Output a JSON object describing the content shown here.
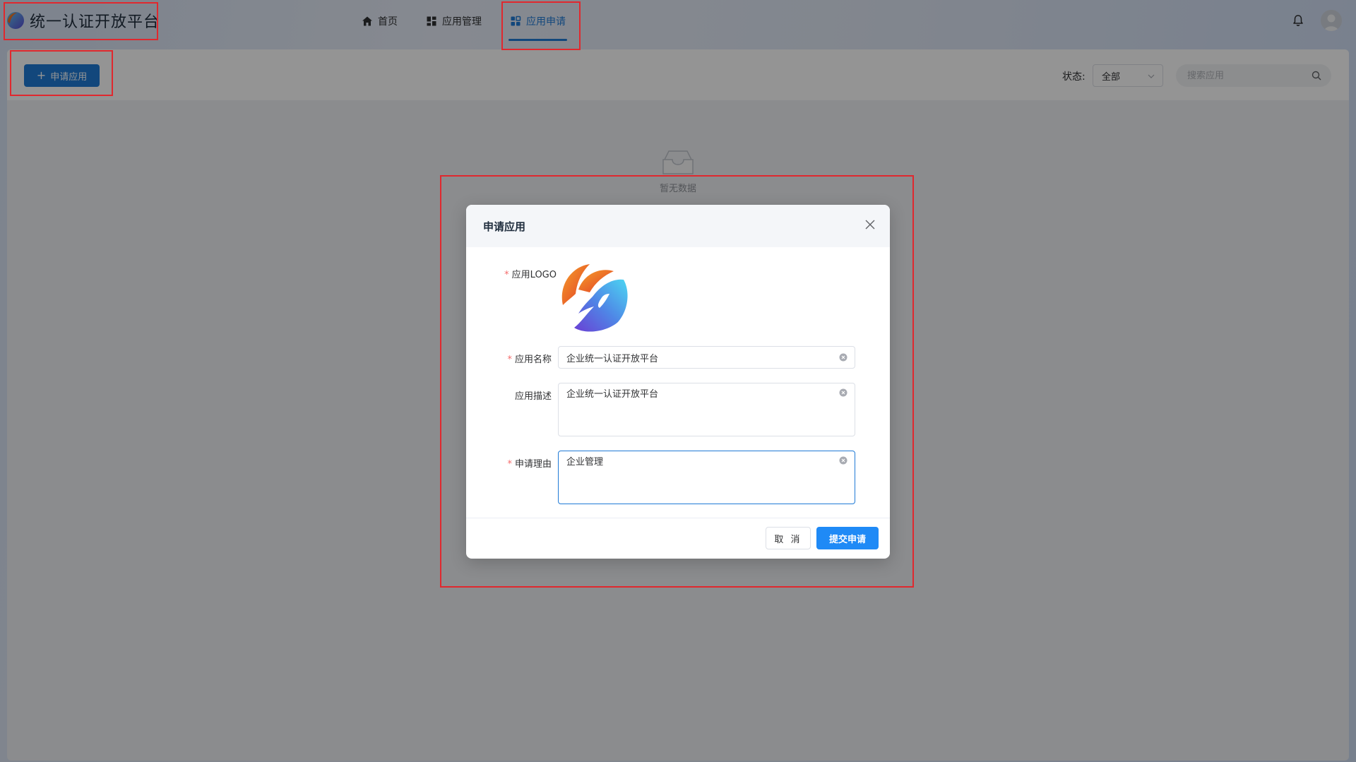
{
  "app": {
    "title": "统一认证开放平台"
  },
  "nav": {
    "items": [
      {
        "label": "首页",
        "icon": "home-icon",
        "active": false
      },
      {
        "label": "应用管理",
        "icon": "dashboard-icon",
        "active": false
      },
      {
        "label": "应用申请",
        "icon": "apps-icon",
        "active": true
      }
    ]
  },
  "toolbar": {
    "apply_label": "申请应用",
    "status_label": "状态:",
    "status_value": "全部",
    "search_placeholder": "搜索应用"
  },
  "empty": {
    "text": "暂无数据"
  },
  "dialog": {
    "title": "申请应用",
    "fields": {
      "logo_label": "应用LOGO",
      "name_label": "应用名称",
      "name_value": "企业统一认证开放平台",
      "desc_label": "应用描述",
      "desc_value": "企业统一认证开放平台",
      "reason_label": "申请理由",
      "reason_value": "企业管理"
    },
    "required_mark": "*",
    "cancel_label": "取 消",
    "submit_label": "提交申请"
  },
  "colors": {
    "primary": "#1f7ad6",
    "submit": "#1f8af6",
    "required": "#f56c6c",
    "annotation": "#e0282e"
  }
}
